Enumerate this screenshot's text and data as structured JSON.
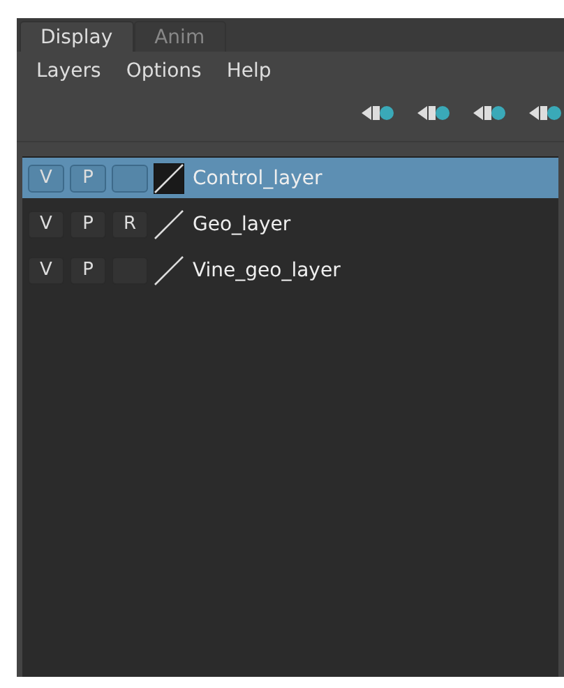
{
  "tabs": [
    {
      "label": "Display",
      "selected": true
    },
    {
      "label": "Anim",
      "selected": false
    }
  ],
  "menu": [
    "Layers",
    "Options",
    "Help"
  ],
  "layers": [
    {
      "name": "Control_layer",
      "selected": true,
      "visible": "V",
      "playback": "P",
      "color_swatch": true
    },
    {
      "name": "Geo_layer",
      "selected": false,
      "visible": "V",
      "playback": "P",
      "ref": "R",
      "color_swatch": false
    },
    {
      "name": "Vine_geo_layer",
      "selected": false,
      "visible": "V",
      "playback": "P",
      "color_swatch": false
    }
  ]
}
